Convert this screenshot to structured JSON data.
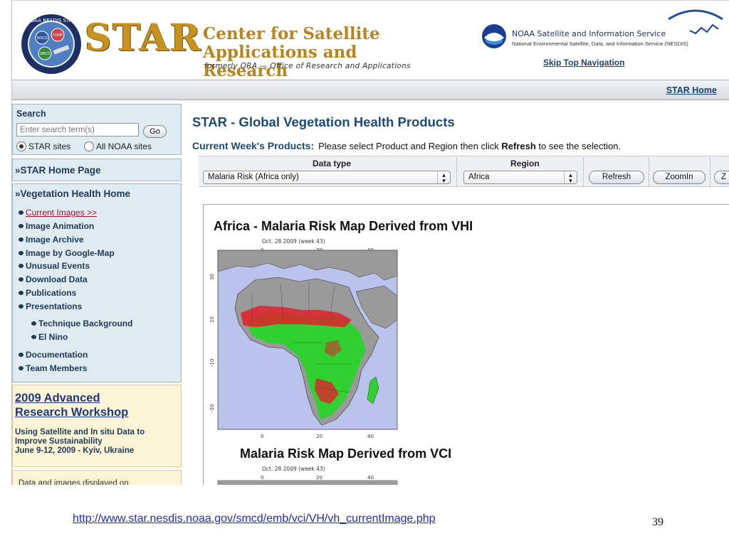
{
  "header": {
    "star_logo": "STAR",
    "center_title_line1": "Center for Satellite",
    "center_title_line2": "Applications and Research",
    "center_subtitle": "formerly ORA — Office of Research and Applications",
    "noaa_title": "NOAA Satellite and Information Service",
    "noaa_subtitle": "National Environmental Satellite, Data, and Information Service (NESDIS)",
    "skip_nav": "Skip Top Navigation",
    "seal_text": "NOAA NESDIS STAR",
    "seal_labels": [
      "SOCD",
      "CORP",
      "SMCD"
    ]
  },
  "navbar": {
    "star_home": "STAR Home"
  },
  "sidebar": {
    "search": {
      "title": "Search",
      "placeholder": "Enter search term(s)",
      "go": "Go",
      "options": [
        {
          "label": "STAR sites",
          "selected": true
        },
        {
          "label": "All NOAA sites",
          "selected": false
        }
      ]
    },
    "home_link": "»STAR Home Page",
    "veg_home": "»Vegetation Health Home",
    "menu": [
      "Current Images >>",
      "Image Animation",
      "Image Archive",
      "Image by Google-Map",
      "Unusual Events",
      "Download Data",
      "Publications",
      "Presentations"
    ],
    "submenu": [
      "Technique Background",
      "El Nino"
    ],
    "menu2": [
      "Documentation",
      "Team Members"
    ],
    "workshop": {
      "title_line1": "2009 Advanced",
      "title_line2": "Research Workshop",
      "line1": "Using Satellite and In situ Data to",
      "line2": "Improve Sustainability",
      "line3": "June 9-12, 2009 - Kyiv, Ukraine"
    },
    "note": "Data and images displayed on"
  },
  "main": {
    "title": "STAR - Global Vegetation Health Products",
    "current_label": "Current Week's Products:",
    "instruction_pre": "Please select Product and Region then click ",
    "instruction_bold": "Refresh",
    "instruction_post": " to see the selection.",
    "data_type_label": "Data type",
    "data_type_value": "Malaria Risk (Africa only)",
    "region_label": "Region",
    "region_value": "Africa",
    "refresh": "Refresh",
    "zoomin": "ZoomIn",
    "next_button_partial": "Z",
    "map1_title": "Africa - Malaria Risk Map Derived from VHI",
    "map2_title": "Malaria Risk Map Derived from VCI",
    "map_date": "Oct. 28 2009 (week 43)",
    "lon_ticks": [
      "0",
      "20",
      "40"
    ],
    "lat_ticks": [
      "30",
      "10",
      "-10",
      "-30"
    ]
  },
  "footer": {
    "url": "http://www.star.nesdis.noaa.gov/smcd/emb/vci/VH/vh_currentImage.php",
    "slide_number": "39"
  },
  "colors": {
    "star_gold": "#c8921e",
    "link_blue": "#1e4a78",
    "sidebar_bg": "#dfeaf1",
    "workshop_bg": "#fbf4d5",
    "ocean": "#b9c3ec",
    "land": "#9a9a9a",
    "vegetation": "#2fd02f",
    "risk": "#e0202a"
  }
}
